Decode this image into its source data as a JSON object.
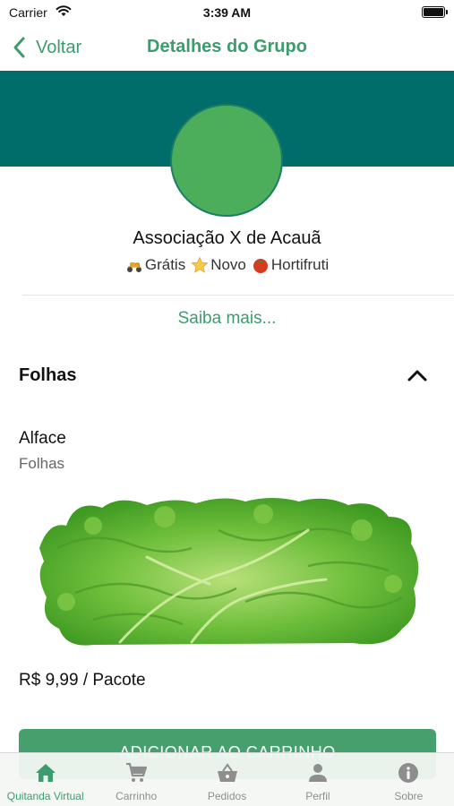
{
  "status_bar": {
    "carrier": "Carrier",
    "time": "3:39 AM"
  },
  "nav": {
    "back_label": "Voltar",
    "title": "Detalhes do Grupo"
  },
  "group": {
    "name": "Associação X de Acauã",
    "tags": [
      {
        "icon": "scooter-icon",
        "label": "Grátis"
      },
      {
        "icon": "star-icon",
        "label": "Novo"
      },
      {
        "icon": "tomato-icon",
        "label": "Hortifruti"
      }
    ],
    "more_link": "Saiba mais..."
  },
  "section": {
    "title": "Folhas",
    "expanded": true
  },
  "product": {
    "name": "Alface",
    "category": "Folhas",
    "price": "R$ 9,99 / Pacote",
    "add_button": "ADICIONAR AO CARRINHO"
  },
  "tab_bar": {
    "active": "Quitanda Virtual",
    "tabs": [
      {
        "icon": "home-icon",
        "label": "Quitanda Virtual"
      },
      {
        "icon": "cart-icon",
        "label": "Carrinho"
      },
      {
        "icon": "basket-icon",
        "label": "Pedidos"
      },
      {
        "icon": "person-icon",
        "label": "Perfil"
      },
      {
        "icon": "info-icon",
        "label": "Sobre"
      }
    ]
  },
  "colors": {
    "accent": "#3d9c6e",
    "header_band": "#006d6a",
    "avatar": "#4cae5b",
    "button": "#46a06e"
  }
}
